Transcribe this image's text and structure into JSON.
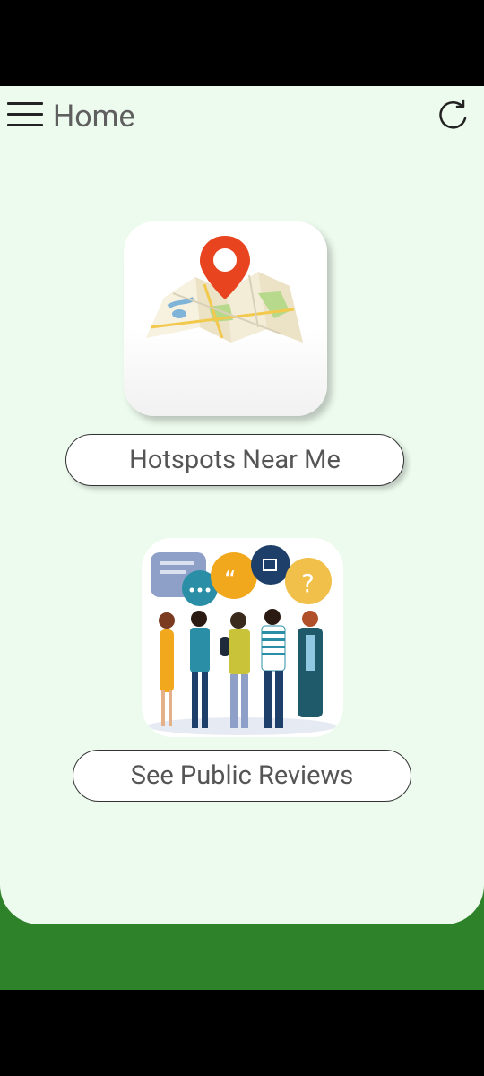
{
  "header": {
    "title": "Home",
    "menu_icon": "hamburger-menu-icon",
    "refresh_icon": "refresh-icon"
  },
  "cards": [
    {
      "label": "Hotspots Near Me",
      "illustration": "map-pin-illustration"
    },
    {
      "label": "See Public Reviews",
      "illustration": "people-reviews-illustration"
    }
  ],
  "colors": {
    "panel": "#edfbee",
    "band": "#2e8229",
    "pin": "#e8441f",
    "text": "#5f5f5f"
  }
}
